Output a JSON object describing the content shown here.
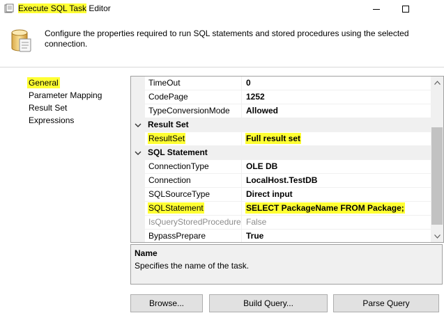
{
  "window": {
    "title_highlight": "Execute SQL Task",
    "title_rest": " Editor"
  },
  "header": {
    "description": "Configure the properties required to run SQL statements and stored procedures using the selected connection."
  },
  "nav": {
    "items": [
      {
        "label": "General",
        "highlighted": true
      },
      {
        "label": "Parameter Mapping",
        "highlighted": false
      },
      {
        "label": "Result Set",
        "highlighted": false
      },
      {
        "label": "Expressions",
        "highlighted": false
      }
    ]
  },
  "grid": {
    "rows": [
      {
        "kind": "prop",
        "name": "TimeOut",
        "value": "0"
      },
      {
        "kind": "prop",
        "name": "CodePage",
        "value": "1252"
      },
      {
        "kind": "prop",
        "name": "TypeConversionMode",
        "value": "Allowed"
      },
      {
        "kind": "category",
        "name": "Result Set"
      },
      {
        "kind": "prop",
        "name": "ResultSet",
        "value": "Full result set",
        "highlighted": true
      },
      {
        "kind": "category",
        "name": "SQL Statement"
      },
      {
        "kind": "prop",
        "name": "ConnectionType",
        "value": "OLE DB"
      },
      {
        "kind": "prop",
        "name": "Connection",
        "value": "LocalHost.TestDB"
      },
      {
        "kind": "prop",
        "name": "SQLSourceType",
        "value": "Direct input"
      },
      {
        "kind": "prop",
        "name": "SQLStatement",
        "value": "SELECT PackageName FROM Package;",
        "highlighted": true
      },
      {
        "kind": "prop",
        "name": "IsQueryStoredProcedure",
        "value": "False",
        "disabled": true
      },
      {
        "kind": "prop",
        "name": "BypassPrepare",
        "value": "True"
      }
    ]
  },
  "description_panel": {
    "title": "Name",
    "text": "Specifies the name of the task."
  },
  "buttons": {
    "browse": "Browse...",
    "build_query": "Build Query...",
    "parse_query": "Parse Query"
  },
  "colors": {
    "highlight": "#ffff33",
    "panel_gray": "#f0f0f0",
    "disabled_text": "#8c8c8c"
  }
}
